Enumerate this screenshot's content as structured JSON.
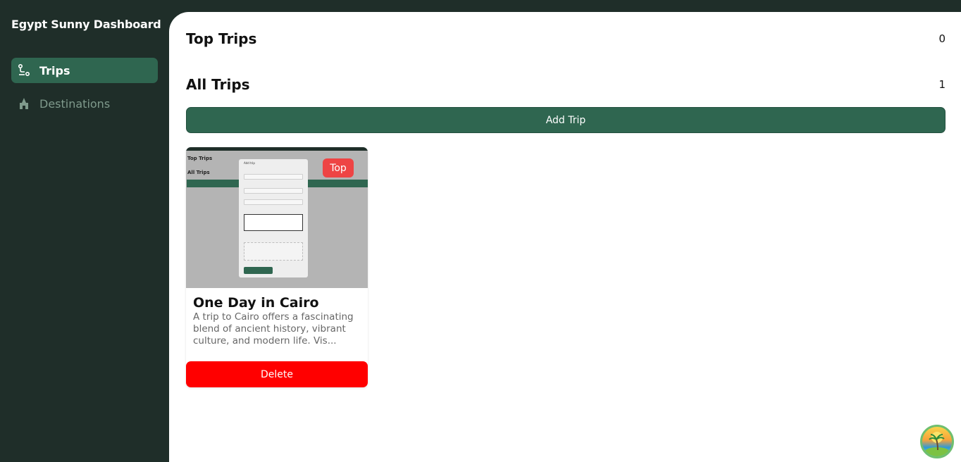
{
  "sidebar": {
    "brand": "Egypt Sunny Dashboard",
    "items": [
      {
        "label": "Trips",
        "icon": "route-icon",
        "active": true
      },
      {
        "label": "Destinations",
        "icon": "landmark-icon",
        "active": false
      }
    ]
  },
  "main": {
    "top_trips": {
      "title": "Top Trips",
      "count": "0"
    },
    "all_trips": {
      "title": "All Trips",
      "count": "1"
    },
    "add_trip_label": "Add Trip",
    "trips": [
      {
        "title": "One Day in Cairo",
        "description": "A trip to Cairo offers a fascinating blend of ancient history, vibrant culture, and modern life. Vis...",
        "badge": "Top",
        "delete_label": "Delete",
        "thumbnail": {
          "heading_top": "Top Trips",
          "heading_all": "All Trips",
          "modal_title": "Add trip"
        }
      }
    ]
  },
  "colors": {
    "sidebar_bg": "#1f2e29",
    "accent": "#2f6650",
    "badge": "#ee4444",
    "danger": "#ff0000"
  },
  "floating_button_icon": "palm-sun-logo-icon"
}
